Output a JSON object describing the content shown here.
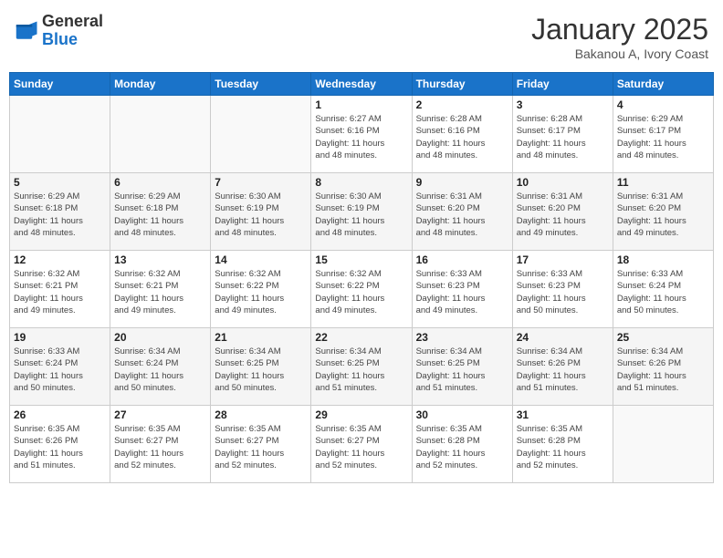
{
  "header": {
    "logo_general": "General",
    "logo_blue": "Blue",
    "month_title": "January 2025",
    "location": "Bakanou A, Ivory Coast"
  },
  "weekdays": [
    "Sunday",
    "Monday",
    "Tuesday",
    "Wednesday",
    "Thursday",
    "Friday",
    "Saturday"
  ],
  "weeks": [
    [
      {
        "day": "",
        "detail": ""
      },
      {
        "day": "",
        "detail": ""
      },
      {
        "day": "",
        "detail": ""
      },
      {
        "day": "1",
        "detail": "Sunrise: 6:27 AM\nSunset: 6:16 PM\nDaylight: 11 hours\nand 48 minutes."
      },
      {
        "day": "2",
        "detail": "Sunrise: 6:28 AM\nSunset: 6:16 PM\nDaylight: 11 hours\nand 48 minutes."
      },
      {
        "day": "3",
        "detail": "Sunrise: 6:28 AM\nSunset: 6:17 PM\nDaylight: 11 hours\nand 48 minutes."
      },
      {
        "day": "4",
        "detail": "Sunrise: 6:29 AM\nSunset: 6:17 PM\nDaylight: 11 hours\nand 48 minutes."
      }
    ],
    [
      {
        "day": "5",
        "detail": "Sunrise: 6:29 AM\nSunset: 6:18 PM\nDaylight: 11 hours\nand 48 minutes."
      },
      {
        "day": "6",
        "detail": "Sunrise: 6:29 AM\nSunset: 6:18 PM\nDaylight: 11 hours\nand 48 minutes."
      },
      {
        "day": "7",
        "detail": "Sunrise: 6:30 AM\nSunset: 6:19 PM\nDaylight: 11 hours\nand 48 minutes."
      },
      {
        "day": "8",
        "detail": "Sunrise: 6:30 AM\nSunset: 6:19 PM\nDaylight: 11 hours\nand 48 minutes."
      },
      {
        "day": "9",
        "detail": "Sunrise: 6:31 AM\nSunset: 6:20 PM\nDaylight: 11 hours\nand 48 minutes."
      },
      {
        "day": "10",
        "detail": "Sunrise: 6:31 AM\nSunset: 6:20 PM\nDaylight: 11 hours\nand 49 minutes."
      },
      {
        "day": "11",
        "detail": "Sunrise: 6:31 AM\nSunset: 6:20 PM\nDaylight: 11 hours\nand 49 minutes."
      }
    ],
    [
      {
        "day": "12",
        "detail": "Sunrise: 6:32 AM\nSunset: 6:21 PM\nDaylight: 11 hours\nand 49 minutes."
      },
      {
        "day": "13",
        "detail": "Sunrise: 6:32 AM\nSunset: 6:21 PM\nDaylight: 11 hours\nand 49 minutes."
      },
      {
        "day": "14",
        "detail": "Sunrise: 6:32 AM\nSunset: 6:22 PM\nDaylight: 11 hours\nand 49 minutes."
      },
      {
        "day": "15",
        "detail": "Sunrise: 6:32 AM\nSunset: 6:22 PM\nDaylight: 11 hours\nand 49 minutes."
      },
      {
        "day": "16",
        "detail": "Sunrise: 6:33 AM\nSunset: 6:23 PM\nDaylight: 11 hours\nand 49 minutes."
      },
      {
        "day": "17",
        "detail": "Sunrise: 6:33 AM\nSunset: 6:23 PM\nDaylight: 11 hours\nand 50 minutes."
      },
      {
        "day": "18",
        "detail": "Sunrise: 6:33 AM\nSunset: 6:24 PM\nDaylight: 11 hours\nand 50 minutes."
      }
    ],
    [
      {
        "day": "19",
        "detail": "Sunrise: 6:33 AM\nSunset: 6:24 PM\nDaylight: 11 hours\nand 50 minutes."
      },
      {
        "day": "20",
        "detail": "Sunrise: 6:34 AM\nSunset: 6:24 PM\nDaylight: 11 hours\nand 50 minutes."
      },
      {
        "day": "21",
        "detail": "Sunrise: 6:34 AM\nSunset: 6:25 PM\nDaylight: 11 hours\nand 50 minutes."
      },
      {
        "day": "22",
        "detail": "Sunrise: 6:34 AM\nSunset: 6:25 PM\nDaylight: 11 hours\nand 51 minutes."
      },
      {
        "day": "23",
        "detail": "Sunrise: 6:34 AM\nSunset: 6:25 PM\nDaylight: 11 hours\nand 51 minutes."
      },
      {
        "day": "24",
        "detail": "Sunrise: 6:34 AM\nSunset: 6:26 PM\nDaylight: 11 hours\nand 51 minutes."
      },
      {
        "day": "25",
        "detail": "Sunrise: 6:34 AM\nSunset: 6:26 PM\nDaylight: 11 hours\nand 51 minutes."
      }
    ],
    [
      {
        "day": "26",
        "detail": "Sunrise: 6:35 AM\nSunset: 6:26 PM\nDaylight: 11 hours\nand 51 minutes."
      },
      {
        "day": "27",
        "detail": "Sunrise: 6:35 AM\nSunset: 6:27 PM\nDaylight: 11 hours\nand 52 minutes."
      },
      {
        "day": "28",
        "detail": "Sunrise: 6:35 AM\nSunset: 6:27 PM\nDaylight: 11 hours\nand 52 minutes."
      },
      {
        "day": "29",
        "detail": "Sunrise: 6:35 AM\nSunset: 6:27 PM\nDaylight: 11 hours\nand 52 minutes."
      },
      {
        "day": "30",
        "detail": "Sunrise: 6:35 AM\nSunset: 6:28 PM\nDaylight: 11 hours\nand 52 minutes."
      },
      {
        "day": "31",
        "detail": "Sunrise: 6:35 AM\nSunset: 6:28 PM\nDaylight: 11 hours\nand 52 minutes."
      },
      {
        "day": "",
        "detail": ""
      }
    ]
  ]
}
